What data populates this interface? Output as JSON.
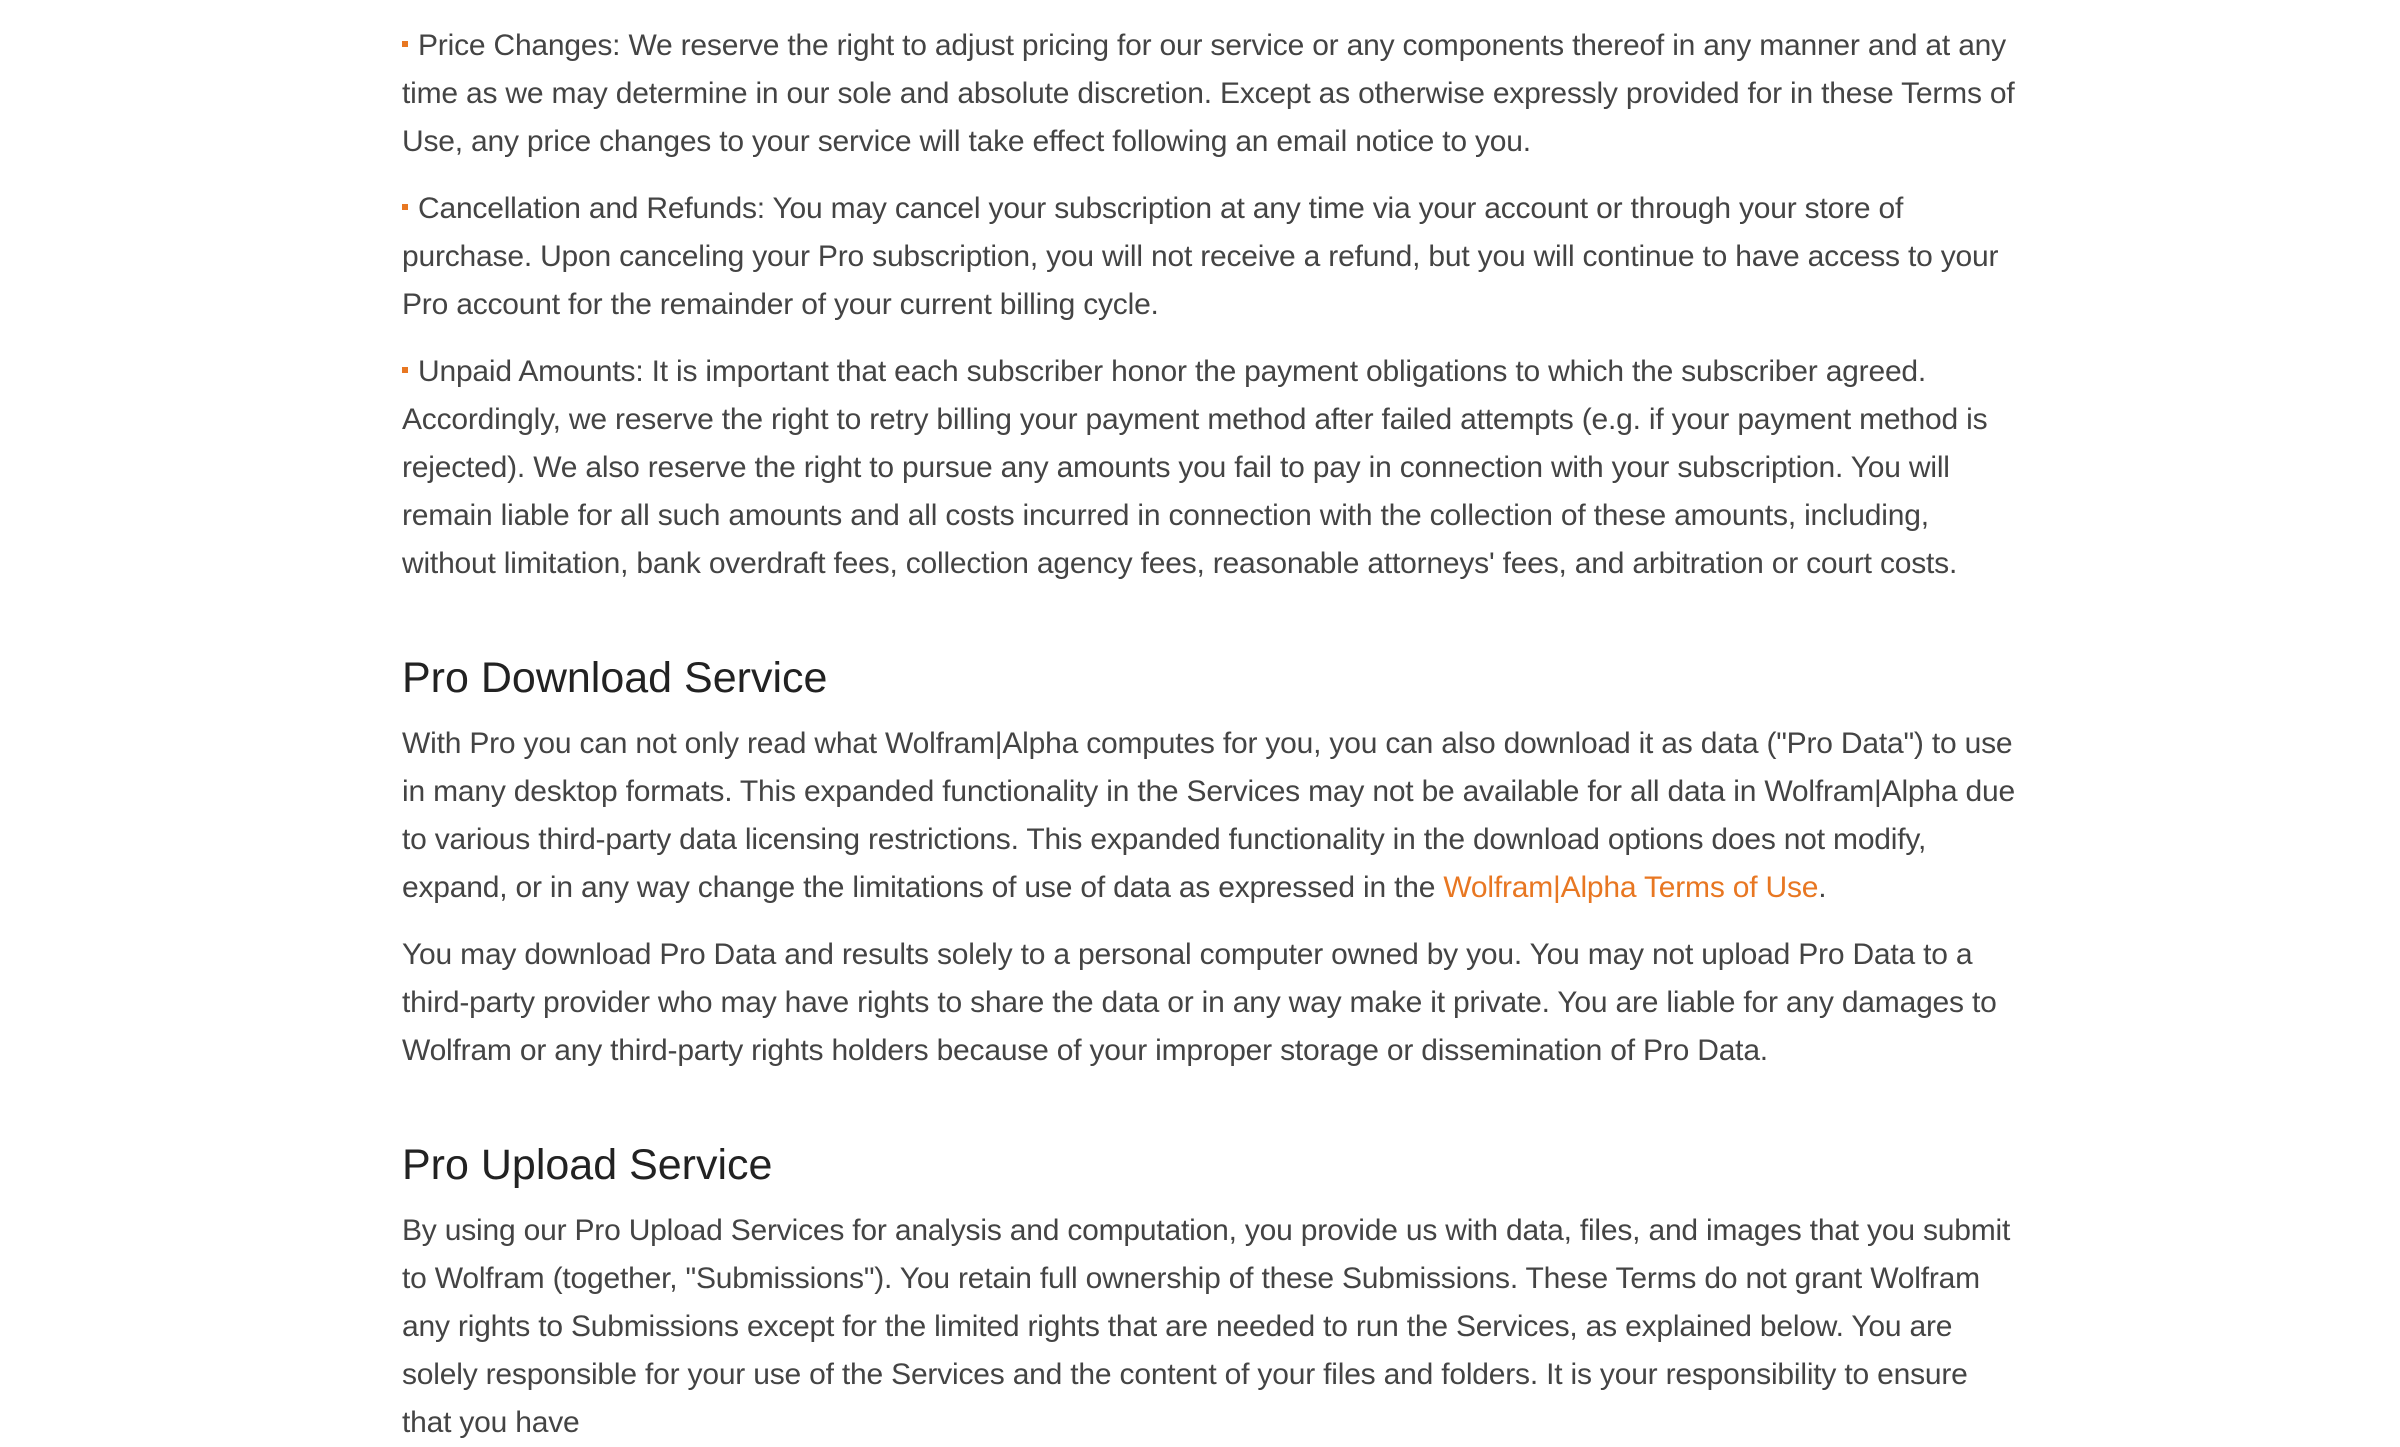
{
  "bullets": [
    {
      "text": "Price Changes: We reserve the right to adjust pricing for our service or any components thereof in any manner and at any time as we may determine in our sole and absolute discretion. Except as otherwise expressly provided for in these Terms of Use, any price changes to your service will take effect following an email notice to you."
    },
    {
      "text": "Cancellation and Refunds: You may cancel your subscription at any time via your account or through your store of purchase. Upon canceling your Pro subscription, you will not receive a refund, but you will continue to have access to your Pro account for the remainder of your current billing cycle."
    },
    {
      "text": "Unpaid Amounts: It is important that each subscriber honor the payment obligations to which the subscriber agreed. Accordingly, we reserve the right to retry billing your payment method after failed attempts (e.g. if your payment method is rejected). We also reserve the right to pursue any amounts you fail to pay in connection with your subscription. You will remain liable for all such amounts and all costs incurred in connection with the collection of these amounts, including, without limitation, bank overdraft fees, collection agency fees, reasonable attorneys' fees, and arbitration or court costs."
    }
  ],
  "download_section": {
    "heading": "Pro Download Service",
    "p1_text": "With Pro you can not only read what Wolfram|Alpha computes for you, you can also download it as data (\"Pro Data\") to use in many desktop formats. This expanded functionality in the Services may not be available for all data in Wolfram|Alpha due to various third-party data licensing restrictions. This expanded functionality in the download options does not modify, expand, or in any way change the limitations of use of data as expressed in the ",
    "p1_link": "Wolfram|Alpha Terms of Use",
    "p1_end": ".",
    "p2": "You may download Pro Data and results solely to a personal computer owned by you. You may not upload Pro Data to a third-party provider who may have rights to share the data or in any way make it private. You are liable for any damages to Wolfram or any third-party rights holders because of your improper storage or dissemination of Pro Data."
  },
  "upload_section": {
    "heading": "Pro Upload Service",
    "p1": "By using our Pro Upload Services for analysis and computation, you provide us with data, files, and images that you submit to Wolfram (together, \"Submissions\"). You retain full ownership of these Submissions. These Terms do not grant Wolfram any rights to Submissions except for the limited rights that are needed to run the Services, as explained below. You are solely responsible for your use of the Services and the content of your files and folders. It is your responsibility to ensure that you have"
  },
  "colors": {
    "accent": "#e87722",
    "text": "#444444",
    "heading": "#222222"
  }
}
